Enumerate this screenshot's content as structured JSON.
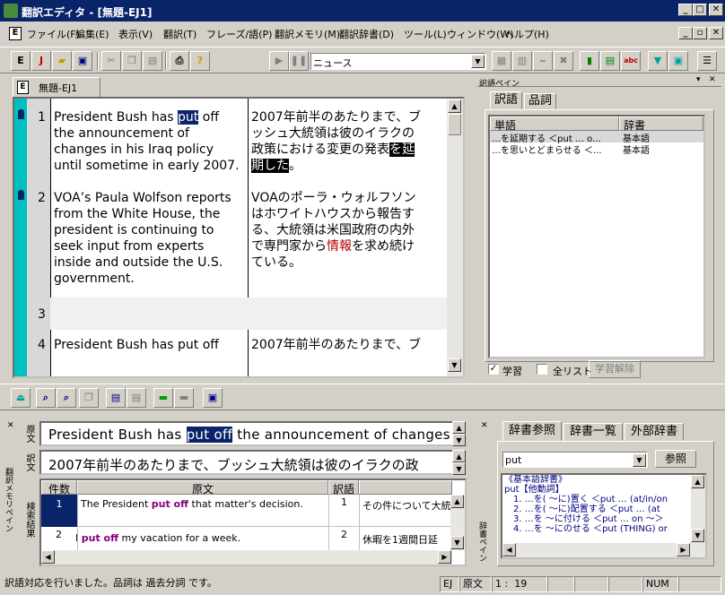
{
  "title": "翻訳エディタ - [無題-EJ1]",
  "menu": [
    "ファイル(F)",
    "編集(E)",
    "表示(V)",
    "翻訳(T)",
    "フレーズ/語(P)",
    "翻訳メモリ(M)",
    "翻訳辞書(D)",
    "ツール(L)",
    "ウィンドウ(W)",
    "ヘルプ(H)"
  ],
  "toolbar": {
    "category": "ニュース"
  },
  "doc_tab": "無題-EJ1",
  "rows": [
    {
      "num": "1",
      "src_pre": "President Bush has ",
      "src_hl": "put",
      "src_post": " off\nthe announcement of\nchanges in his Iraq policy\nuntil sometime in early 2007.",
      "tgt_pre": "2007年前半のあたりまで、ブ\nッシュ大統領は彼のイラクの\n政策における変更の発表",
      "tgt_hl": "を延\n期した",
      "tgt_post": "。"
    },
    {
      "num": "2",
      "src": "VOA’s Paula Wolfson reports\nfrom the White House, the\npresident is continuing to\nseek input from experts\ninside and outside the U.S.\ngovernment.",
      "tgt_pre": "VOAのポーラ・ウォルフソン\nはホワイトハウスから報告す\nる、大統領は米国政府の内外\nで専門家から",
      "tgt_red": "情報",
      "tgt_post": "を求め続け\nている。"
    },
    {
      "num": "3"
    },
    {
      "num": "4",
      "src": "President Bush has put off",
      "tgt": "2007年前半のあたりまで、ブ"
    }
  ],
  "right_pane": {
    "title": "訳語ペイン",
    "tabs": [
      "訳語",
      "品詞"
    ],
    "col_word": "単語",
    "col_dict": "辞書",
    "items": [
      {
        "word": "…を延期する ＜put … o...",
        "dict": "基本語"
      },
      {
        "word": "…を思いとどまらせる ＜...",
        "dict": "基本語"
      }
    ],
    "cb_learn": "学習",
    "cb_all": "全リスト",
    "btn_unlearn": "学習解除"
  },
  "memory": {
    "label_src": "原文",
    "label_tgt": "訳文",
    "label_search": "検索結果",
    "side": "翻訳メモリペイン",
    "src_pre": "President Bush has ",
    "src_hl": "put off",
    "src_post": " the announcement of changes",
    "tgt": "2007年前半のあたりまで、ブッシュ大統領は彼のイラクの政",
    "col_count": "件数",
    "col_src": "原文",
    "col_tgt": "訳語",
    "results": [
      {
        "n": "1",
        "pre": "The President ",
        "hl": "put off",
        "post": " that matter's decision.",
        "tn": "1",
        "t": "その件について大統"
      },
      {
        "n": "2",
        "pre": "I ",
        "hl": "put off",
        "post": " my vacation for a week.",
        "tn": "2",
        "t": "休暇を1週間日延"
      }
    ]
  },
  "dict": {
    "side": "辞書ペイン",
    "tabs": [
      "辞書参照",
      "辞書一覧",
      "外部辞書"
    ],
    "query": "put",
    "btn": "参照",
    "lines": [
      "《基本語辞書》",
      "put【他動詞】",
      "　1. …を( ～に)置く ＜put … (at/in/on",
      "　2. …を( ～に)配置する ＜put … (at",
      "　3. …を ～に付ける ＜put … on ～＞",
      "　4. …を ～にのせる ＜put (THING) or"
    ]
  },
  "status": {
    "msg": "訳語対応を行いました。品詞は 過去分詞 です。",
    "mode": "EJ",
    "view": "原文",
    "pos": "1 :  19",
    "num": "NUM"
  },
  "colors": {
    "title": "#0a246a",
    "accent": "#00c0c0",
    "highlight": "#0a246a"
  }
}
